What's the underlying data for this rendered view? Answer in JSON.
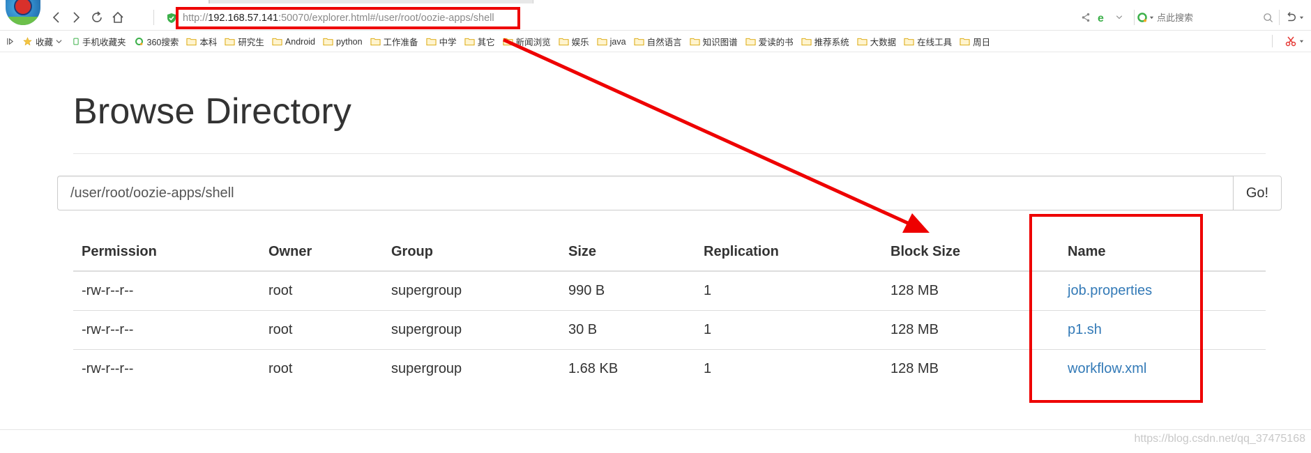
{
  "browser": {
    "url_scheme": "http://",
    "url_host": "192.168.57.141",
    "url_rest": ":50070/explorer.html#/user/root/oozie-apps/shell",
    "search_placeholder": "点此搜索"
  },
  "bookmarks": [
    {
      "label": "收藏",
      "icon": "star-icon"
    },
    {
      "label": "手机收藏夹",
      "icon": "phone-icon"
    },
    {
      "label": "360搜索",
      "icon": "search-360-icon"
    },
    {
      "label": "本科",
      "icon": "folder-icon"
    },
    {
      "label": "研究生",
      "icon": "folder-icon"
    },
    {
      "label": "Android",
      "icon": "folder-icon"
    },
    {
      "label": "python",
      "icon": "folder-icon"
    },
    {
      "label": "工作准备",
      "icon": "folder-icon"
    },
    {
      "label": "中学",
      "icon": "folder-icon"
    },
    {
      "label": "其它",
      "icon": "folder-icon"
    },
    {
      "label": "新闻浏览",
      "icon": "folder-icon"
    },
    {
      "label": "娱乐",
      "icon": "folder-icon"
    },
    {
      "label": "java",
      "icon": "folder-icon"
    },
    {
      "label": "自然语言",
      "icon": "folder-icon"
    },
    {
      "label": "知识图谱",
      "icon": "folder-icon"
    },
    {
      "label": "爱读的书",
      "icon": "folder-icon"
    },
    {
      "label": "推荐系统",
      "icon": "folder-icon"
    },
    {
      "label": "大数据",
      "icon": "folder-icon"
    },
    {
      "label": "在线工具",
      "icon": "folder-icon"
    },
    {
      "label": "周日",
      "icon": "folder-icon"
    }
  ],
  "page": {
    "title": "Browse Directory",
    "path_value": "/user/root/oozie-apps/shell",
    "go_label": "Go!"
  },
  "table": {
    "headers": [
      "Permission",
      "Owner",
      "Group",
      "Size",
      "Replication",
      "Block Size",
      "Name"
    ],
    "rows": [
      [
        "-rw-r--r--",
        "root",
        "supergroup",
        "990 B",
        "1",
        "128 MB",
        "job.properties"
      ],
      [
        "-rw-r--r--",
        "root",
        "supergroup",
        "30 B",
        "1",
        "128 MB",
        "p1.sh"
      ],
      [
        "-rw-r--r--",
        "root",
        "supergroup",
        "1.68 KB",
        "1",
        "128 MB",
        "workflow.xml"
      ]
    ]
  },
  "watermark": "https://blog.csdn.net/qq_37475168",
  "colors": {
    "annotation": "#ee0000",
    "link": "#337ab7",
    "folder": "#f5c542"
  }
}
